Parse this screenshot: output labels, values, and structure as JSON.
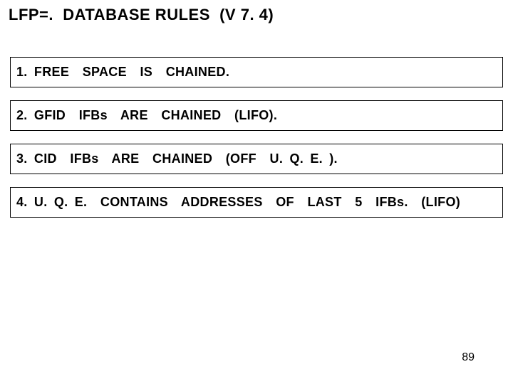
{
  "title": "LFP=.  DATABASE RULES  (V 7. 4)",
  "rules": [
    "1. FREE  SPACE  IS  CHAINED.",
    "2. GFID  IFBs  ARE  CHAINED  (LIFO).",
    "3. CID  IFBs  ARE  CHAINED  (OFF  U. Q. E. ).",
    "4. U. Q. E.  CONTAINS  ADDRESSES  OF  LAST  5  IFBs.  (LIFO)"
  ],
  "page_number": "89"
}
